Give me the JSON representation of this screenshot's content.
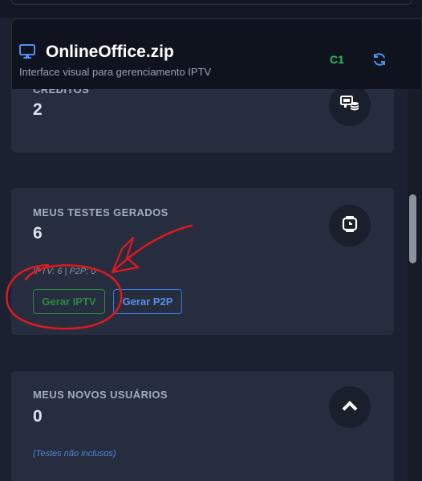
{
  "header": {
    "title": "OnlineOffice.zip",
    "subtitle": "Interface visual para gerenciamento IPTV",
    "badge": "C1",
    "monitor_icon": "monitor-icon",
    "refresh_icon": "refresh-icon"
  },
  "cards": {
    "credits": {
      "label": "CRÉDITOS",
      "value": "2",
      "icon": "server-money-icon"
    },
    "tests": {
      "label": "MEUS TESTES GERADOS",
      "value": "6",
      "breakdown": "IPTV: 6 | P2P: 0",
      "icon": "stopwatch-icon",
      "buttons": {
        "iptv": "Gerar IPTV",
        "p2p": "Gerar P2P"
      }
    },
    "new_users": {
      "label": "MEUS NOVOS USUÁRIOS",
      "value": "0",
      "note": "(Testes não inclusos)",
      "icon": "chevron-up-icon"
    }
  },
  "colors": {
    "background": "#1b2130",
    "card": "#262d3e",
    "header": "#0f131d",
    "accent_green": "#22c55e",
    "accent_blue": "#3d7be0",
    "annotation_red": "#e0191f"
  }
}
